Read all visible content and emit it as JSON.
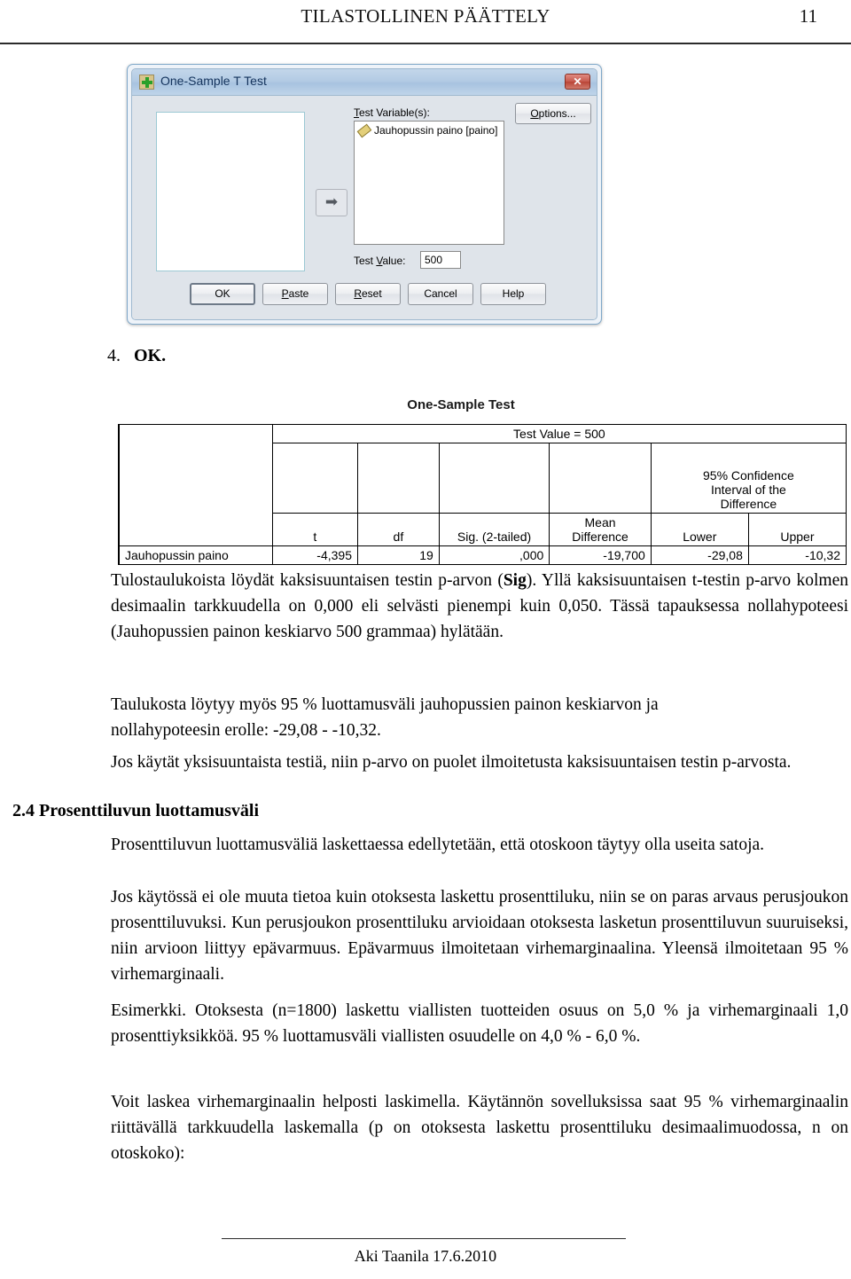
{
  "header": {
    "title": "TILASTOLLINEN PÄÄTTELY",
    "page_number": "11"
  },
  "dialog": {
    "title": "One-Sample T Test",
    "icon": "spss-dialog-icon",
    "close_label": "✕",
    "move_arrow": "➡",
    "test_variables_label_pre": "T",
    "test_variables_label_post": "est Variable(s):",
    "test_variable_item": "Jauhopussin paino [paino]",
    "options_label_pre": "O",
    "options_label_post": "ptions...",
    "test_value_label_pre": "Test ",
    "test_value_label_mid": "V",
    "test_value_label_post": "alue:",
    "test_value": "500",
    "buttons": {
      "ok": "OK",
      "paste_pre": "P",
      "paste_post": "aste",
      "reset_pre": "R",
      "reset_post": "eset",
      "cancel": "Cancel",
      "help": "Help"
    }
  },
  "step": {
    "number": "4.",
    "label": "OK."
  },
  "output": {
    "title": "One-Sample Test",
    "test_value_header": "Test Value = 500",
    "ci_header_line1": "95% Confidence",
    "ci_header_line2": "Interval of the",
    "ci_header_line3": "Difference",
    "col_t": "t",
    "col_df": "df",
    "col_sig": "Sig. (2-tailed)",
    "col_mean_line1": "Mean",
    "col_mean_line2": "Difference",
    "col_lower": "Lower",
    "col_upper": "Upper",
    "row_label": "Jauhopussin paino",
    "row_t": "-4,395",
    "row_df": "19",
    "row_sig": ",000",
    "row_mean_diff": "-19,700",
    "row_lower": "-29,08",
    "row_upper": "-10,32"
  },
  "body": {
    "p1_part1": "Tulostaulukoista löydät kaksisuuntaisen testin p-arvon (",
    "p1_bold": "Sig",
    "p1_part2": "). Yllä kaksisuuntaisen t-testin p-arvo kolmen desimaalin tarkkuudella on 0,000 eli selvästi pienempi kuin 0,050. Tässä tapauksessa nollahypoteesi (Jauhopussien painon keskiarvo 500 grammaa) hylätään.",
    "p2": "Taulukosta löytyy myös 95 % luottamusväli jauhopussien painon keskiarvon ja nollahypoteesin erolle: -29,08 - -10,32.",
    "p3": "Jos käytät yksisuuntaista testiä, niin p-arvo on puolet ilmoitetusta kaksisuuntaisen testin p-arvosta.",
    "heading_2_4": "2.4 Prosenttiluvun luottamusväli",
    "p4": "Prosenttiluvun luottamusväliä laskettaessa edellytetään, että otoskoon täytyy olla useita satoja.",
    "p5": "Jos käytössä ei ole muuta tietoa kuin otoksesta laskettu prosenttiluku, niin se on paras arvaus perusjoukon prosenttiluvuksi. Kun perusjoukon prosenttiluku arvioidaan otoksesta lasketun prosenttiluvun suuruiseksi, niin arvioon liittyy epävarmuus. Epävarmuus ilmoitetaan virhemarginaalina. Yleensä ilmoitetaan 95 % virhemarginaali.",
    "p6": "Esimerkki. Otoksesta (n=1800) laskettu viallisten tuotteiden osuus on 5,0 % ja virhemarginaali 1,0 prosenttiyksikköä. 95 % luottamusväli viallisten osuudelle on 4,0 % - 6,0 %.",
    "p7": "Voit laskea virhemarginaalin helposti laskimella. Käytännön sovelluksissa saat 95 % virhemarginaalin riittävällä tarkkuudella laskemalla (p on otoksesta laskettu prosenttiluku desimaalimuodossa, n on otoskoko):"
  },
  "footer": {
    "text": "Aki Taanila 17.6.2010"
  }
}
